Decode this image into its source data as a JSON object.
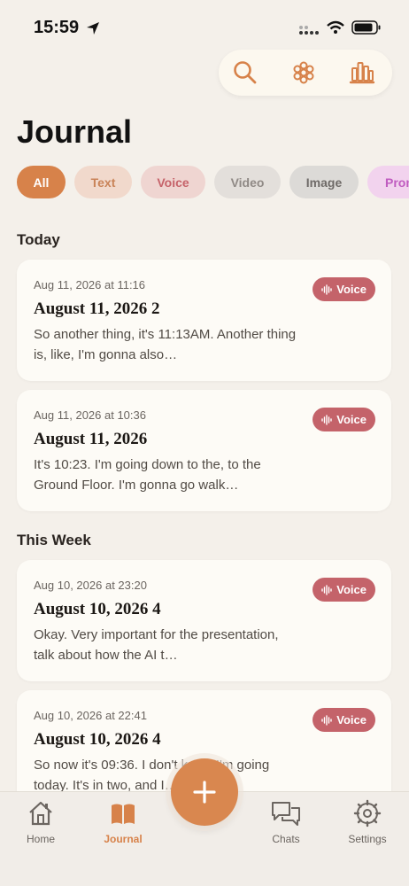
{
  "status": {
    "time": "15:59"
  },
  "header": {
    "title": "Journal"
  },
  "filters": [
    {
      "label": "All",
      "bg": "#d7824a",
      "fg": "#ffffff",
      "width": 55
    },
    {
      "label": "Text",
      "bg": "#f1d9cc",
      "fg": "#c98358",
      "width": 65
    },
    {
      "label": "Voice",
      "bg": "#efd5d1",
      "fg": "#c6636a",
      "width": 73
    },
    {
      "label": "Video",
      "bg": "#e3dfdb",
      "fg": "#908a86",
      "width": 75
    },
    {
      "label": "Image",
      "bg": "#dcdad7",
      "fg": "#6f6b68",
      "width": 78
    },
    {
      "label": "Prom",
      "bg": "#f2d3ee",
      "fg": "#c05cc0",
      "width": 60
    }
  ],
  "sections": {
    "today": "Today",
    "this_week": "This Week"
  },
  "entries": [
    {
      "meta": "Aug 11, 2026 at 11:16",
      "title": "August 11, 2026 2",
      "excerpt": "So another thing, it's 11:13AM. Another thing is, like, I'm gonna also…",
      "badge": "Voice"
    },
    {
      "meta": "Aug 11, 2026 at 10:36",
      "title": "August 11, 2026",
      "excerpt": "It's 10:23. I'm going down to the, to the Ground Floor. I'm gonna go walk…",
      "badge": "Voice"
    },
    {
      "meta": "Aug 10, 2026 at 23:20",
      "title": "August 10, 2026 4",
      "excerpt": "Okay. Very important for the presentation, talk about how the AI t…",
      "badge": "Voice"
    },
    {
      "meta": "Aug 10, 2026 at 22:41",
      "title": "August 10, 2026 4",
      "excerpt": "So now it's 09:36. I don't know I'm going today. It's in two, and I…",
      "badge": "Voice"
    }
  ],
  "tabs": {
    "home": "Home",
    "journal": "Journal",
    "chats": "Chats",
    "settings": "Settings"
  },
  "colors": {
    "accent": "#d7824a",
    "voice_badge": "#c4636a"
  }
}
